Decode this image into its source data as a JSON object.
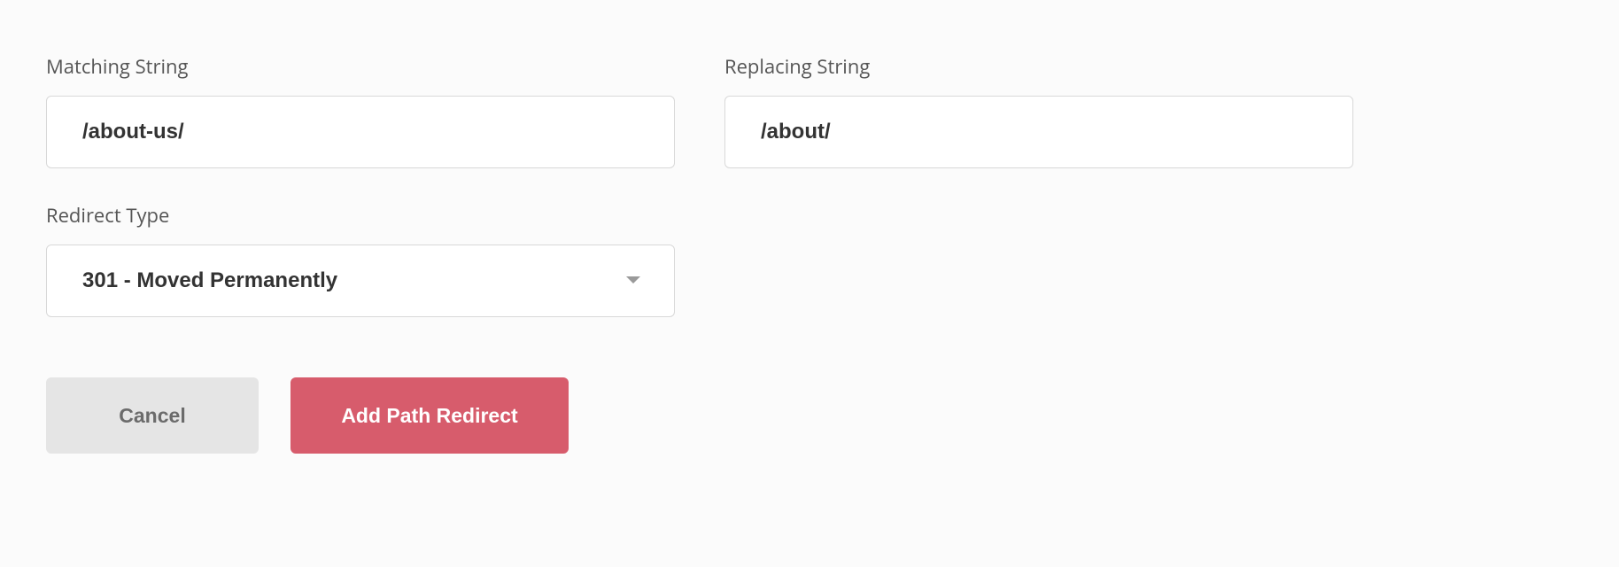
{
  "form": {
    "matching_string": {
      "label": "Matching String",
      "value": "/about-us/"
    },
    "replacing_string": {
      "label": "Replacing String",
      "value": "/about/"
    },
    "redirect_type": {
      "label": "Redirect Type",
      "selected": "301 - Moved Permanently"
    }
  },
  "buttons": {
    "cancel": "Cancel",
    "submit": "Add Path Redirect"
  }
}
